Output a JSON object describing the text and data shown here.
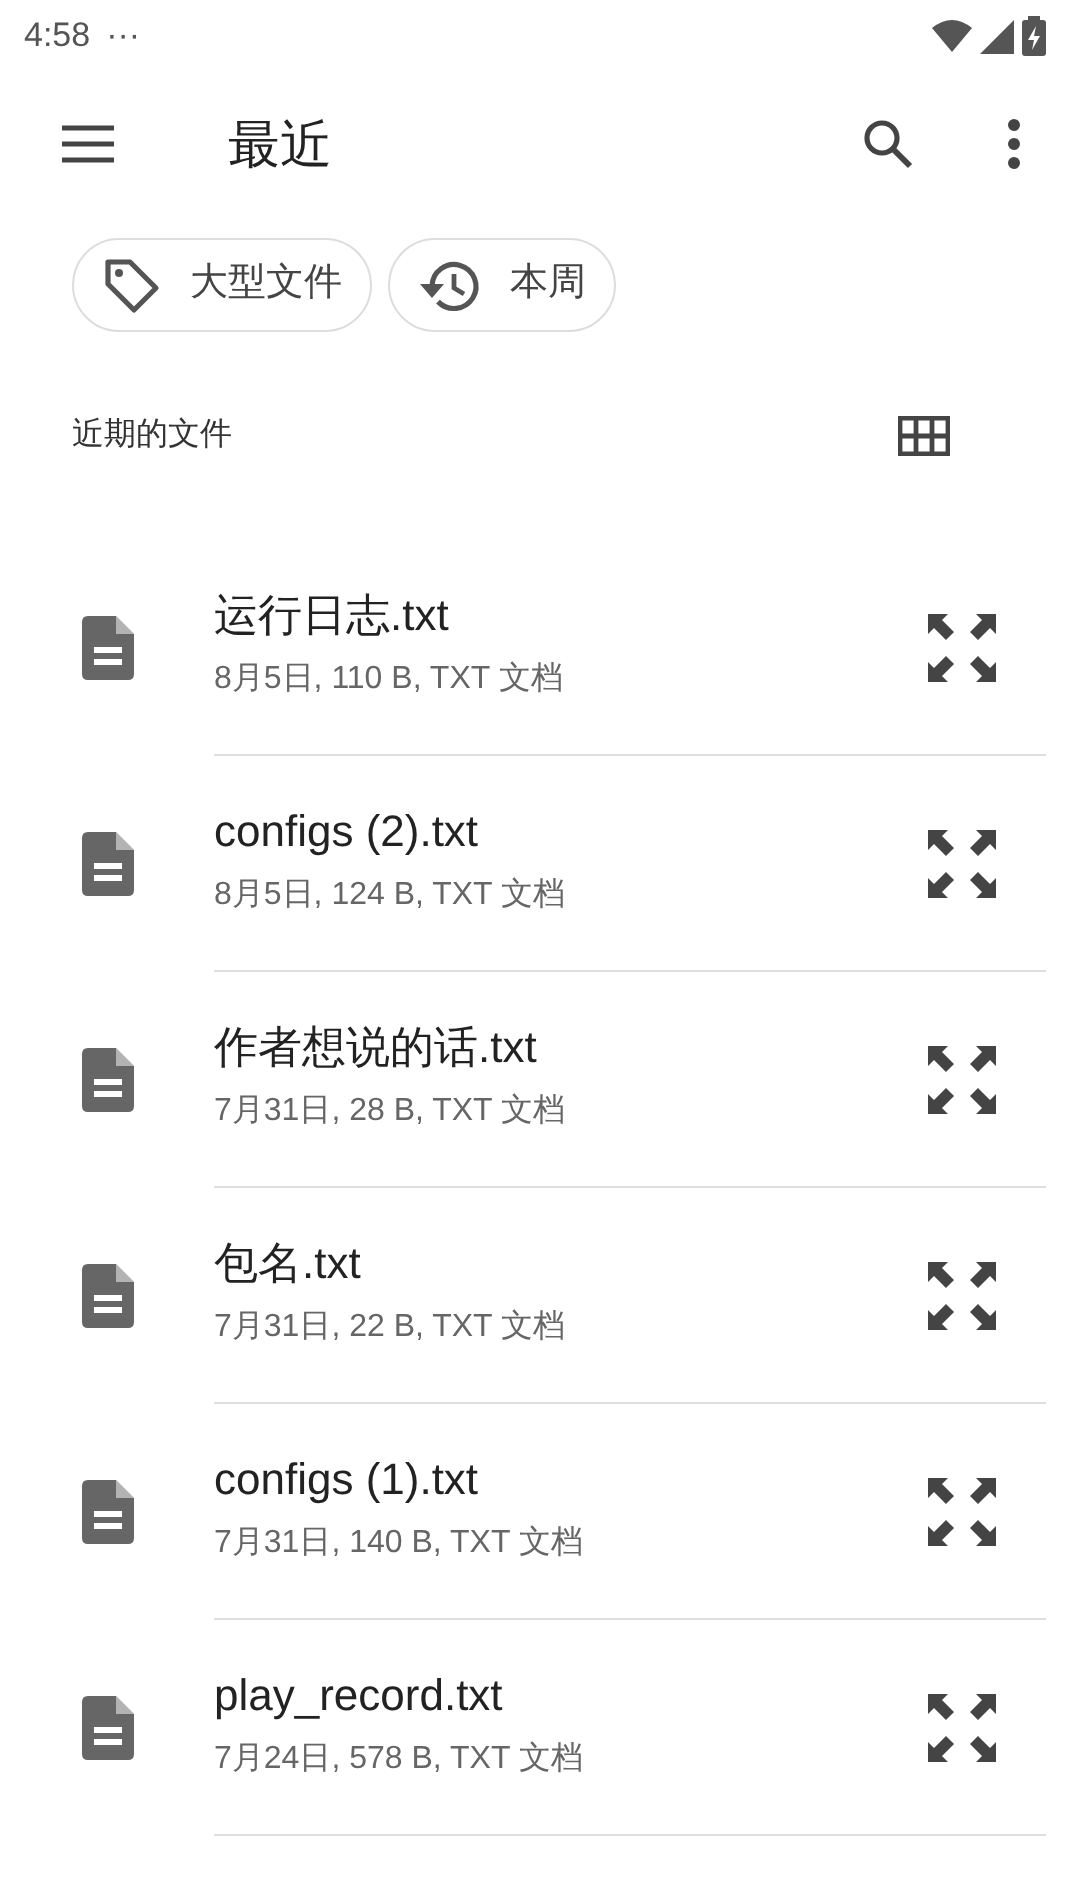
{
  "status_bar": {
    "time": "4:58",
    "notification_dots": "···"
  },
  "app_bar": {
    "title": "最近"
  },
  "chips": [
    {
      "kind": "tag",
      "label": "大型文件"
    },
    {
      "kind": "history",
      "label": "本周"
    }
  ],
  "section": {
    "title": "近期的文件"
  },
  "files": [
    {
      "name": "运行日志.txt",
      "details": "8月5日, 110 B, TXT 文档"
    },
    {
      "name": "configs (2).txt",
      "details": "8月5日, 124 B, TXT 文档"
    },
    {
      "name": "作者想说的话.txt",
      "details": "7月31日, 28 B, TXT 文档"
    },
    {
      "name": "包名.txt",
      "details": "7月31日, 22 B, TXT 文档"
    },
    {
      "name": "configs (1).txt",
      "details": "7月31日, 140 B, TXT 文档"
    },
    {
      "name": "play_record.txt",
      "details": "7月24日, 578 B, TXT 文档"
    }
  ]
}
